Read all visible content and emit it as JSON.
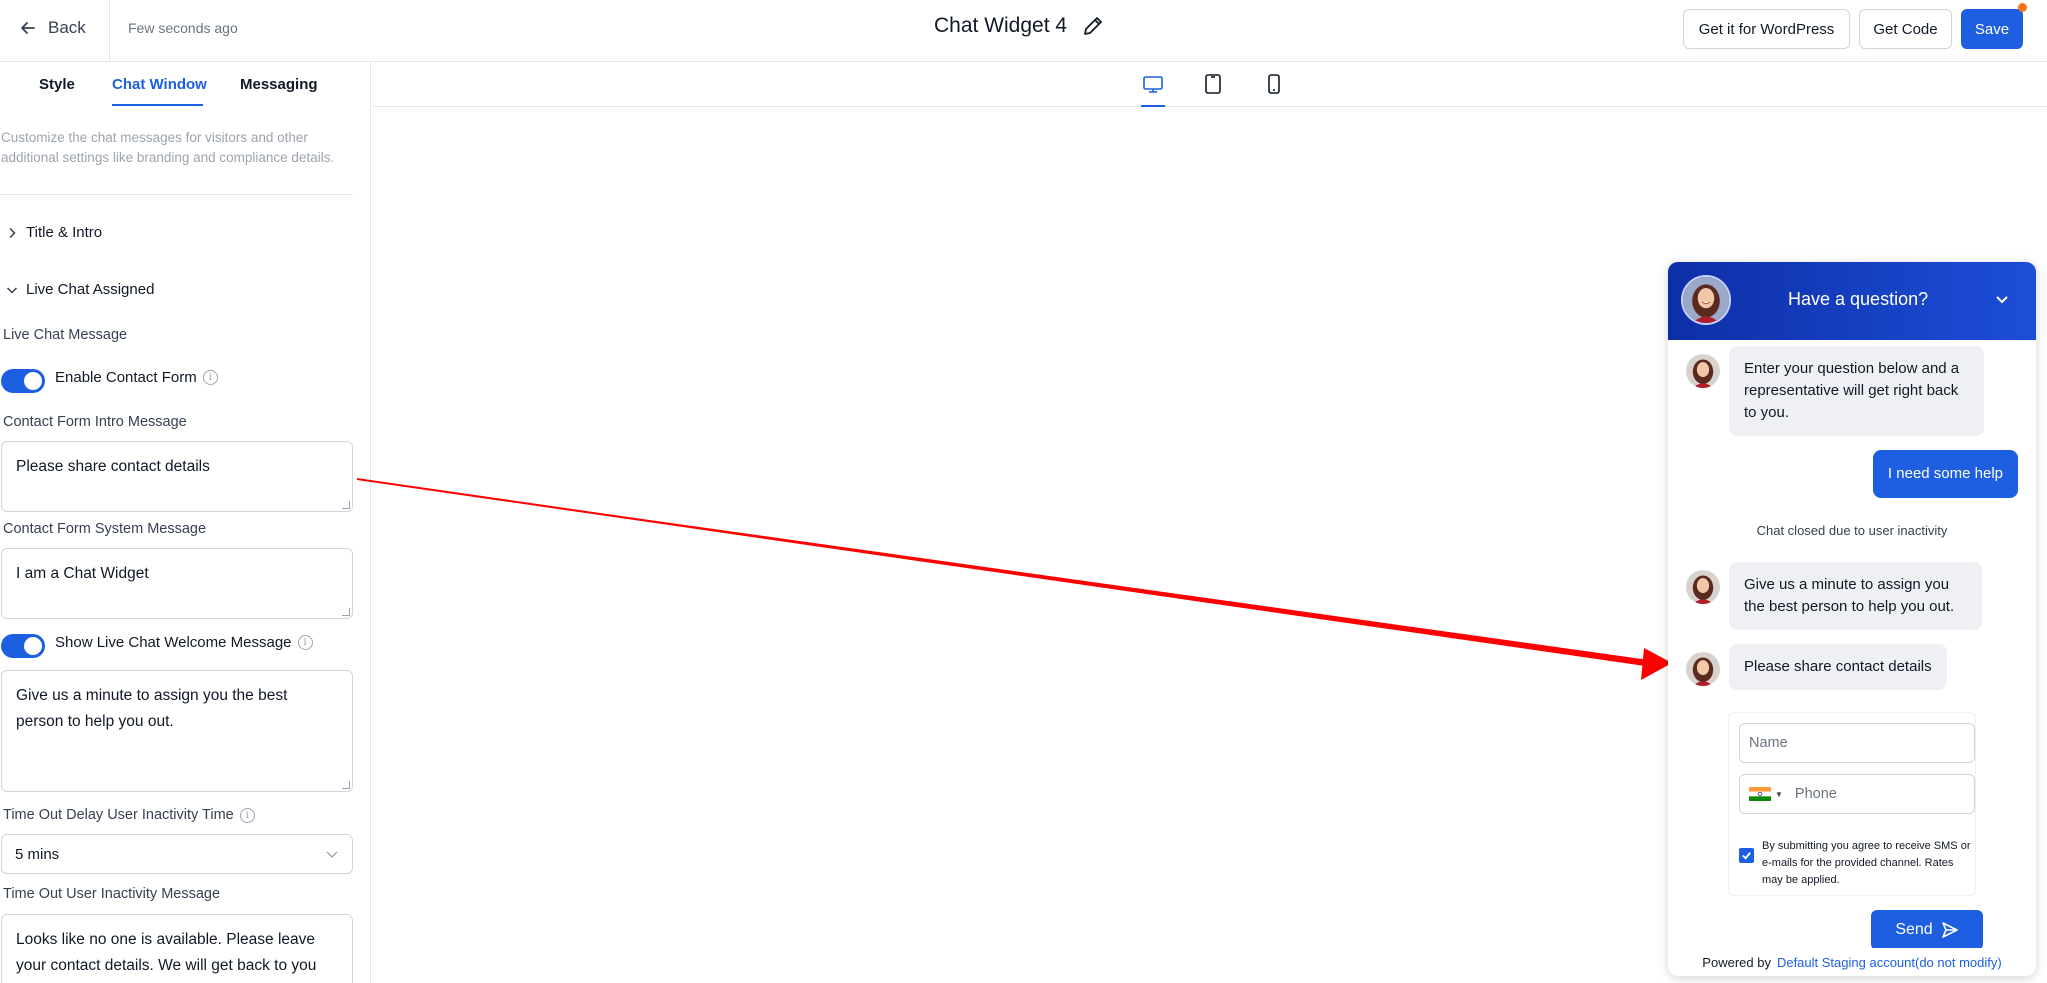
{
  "header": {
    "back_label": "Back",
    "saved_status": "Few seconds ago",
    "title": "Chat Widget 4",
    "wordpress_label": "Get it for WordPress",
    "get_code_label": "Get Code",
    "save_label": "Save"
  },
  "tabs": [
    {
      "label": "Style"
    },
    {
      "label": "Chat Window"
    },
    {
      "label": "Messaging"
    }
  ],
  "active_tab": "Chat Window",
  "panel": {
    "description": "Customize the chat messages for visitors and other additional settings like branding and compliance details.",
    "title_intro_label": "Title & Intro",
    "live_chat_assigned_label": "Live Chat Assigned",
    "live_chat_message_label": "Live Chat Message",
    "enable_contact_form_label": "Enable Contact Form",
    "enable_contact_form_on": true,
    "contact_form_intro_label": "Contact Form Intro Message",
    "contact_form_intro_value": "Please share contact details",
    "contact_form_system_label": "Contact Form System Message",
    "contact_form_system_value": "I am a Chat Widget",
    "show_welcome_label": "Show Live Chat Welcome Message",
    "show_welcome_on": true,
    "welcome_value": "Give us a minute to assign you the best person to help you out.",
    "timeout_delay_label": "Time Out Delay User Inactivity Time",
    "timeout_delay_value": "5 mins",
    "timeout_message_label": "Time Out User Inactivity Message",
    "timeout_message_value": "Looks like no one is available. Please leave your contact details. We will get back to you shortly."
  },
  "preview": {
    "devices": [
      "desktop-icon",
      "tablet-icon",
      "mobile-icon"
    ],
    "active_device": "desktop"
  },
  "widget": {
    "header_title": "Have a question?",
    "header_color": "#1d4ed8",
    "messages": {
      "intro": "Enter your question below and a representative will get right back to you.",
      "user": "I need some help",
      "system": "Chat closed due to user inactivity",
      "welcome": "Give us a minute to assign you the best person to help you out.",
      "contact_prompt": "Please share contact details"
    },
    "form": {
      "name_placeholder": "Name",
      "phone_placeholder": "Phone",
      "consent_text": "By submitting you agree to receive SMS or e-mails for the provided channel. Rates may be applied.",
      "consent_checked": true,
      "send_label": "Send"
    },
    "powered_by_label": "Powered by",
    "powered_by_link": "Default Staging account(do not modify)"
  },
  "colors": {
    "accent": "#1d5fe0",
    "arrow": "#ff0000",
    "save_dot": "#f97316"
  }
}
